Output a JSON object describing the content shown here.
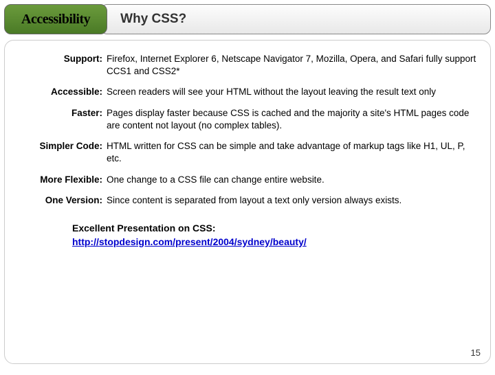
{
  "header": {
    "category": "Accessibility",
    "title": "Why CSS?"
  },
  "rows": [
    {
      "label": "Support:",
      "value": "Firefox, Internet Explorer 6, Netscape Navigator 7, Mozilla, Opera, and Safari fully support CCS1 and CSS2*"
    },
    {
      "label": "Accessible:",
      "value": "Screen readers will see your HTML without the layout leaving the result text only"
    },
    {
      "label": "Faster:",
      "value": "Pages display faster because CSS is cached and the majority a site's HTML pages code are content not layout (no complex tables)."
    },
    {
      "label": "Simpler Code:",
      "value": "HTML written for CSS can be simple and take advantage of markup tags like H1, UL, P, etc."
    },
    {
      "label": "More Flexible:",
      "value": "One change to a CSS file can change entire website."
    },
    {
      "label": "One Version:",
      "value": "Since content is separated from layout a text only version always exists."
    }
  ],
  "footer": {
    "lead": "Excellent Presentation on CSS:",
    "link_text": "http://stopdesign.com/present/2004/sydney/beauty/",
    "link_href": "http://stopdesign.com/present/2004/sydney/beauty/"
  },
  "page_number": "15"
}
